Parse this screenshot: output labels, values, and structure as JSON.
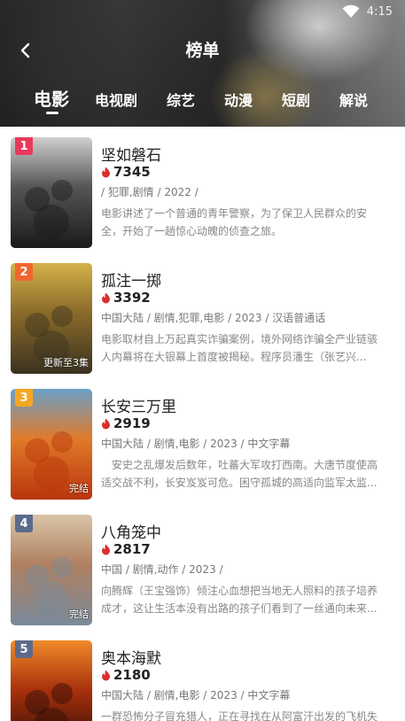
{
  "status_bar": {
    "time": "4:15"
  },
  "header": {
    "title": "榜单"
  },
  "tabs": [
    {
      "label": "电影",
      "active": true
    },
    {
      "label": "电视剧"
    },
    {
      "label": "综艺"
    },
    {
      "label": "动漫"
    },
    {
      "label": "短剧"
    },
    {
      "label": "解说"
    }
  ],
  "items": [
    {
      "rank": "1",
      "badge_color": "#e8395b",
      "title": "坚如磐石",
      "heat": "7345",
      "meta": " / 犯罪,剧情 / 2022 /",
      "desc": "电影讲述了一个普通的青年警察，为了保卫人民群众的安全，开始了一趟惊心动魄的侦查之旅。",
      "poster_label": "",
      "poster_palette": [
        "#1a1a1a",
        "#555555",
        "#cfcfcf"
      ]
    },
    {
      "rank": "2",
      "badge_color": "#f0662e",
      "title": "孤注一掷",
      "heat": "3392",
      "meta": "中国大陆 / 剧情,犯罪,电影 / 2023 / 汉语普通话",
      "desc": "电影取材自上万起真实诈骗案例，境外网络诈骗全产业链骇人内幕将在大银幕上首度被揭秘。程序员潘生（张艺兴...",
      "poster_label": "更新至3集",
      "poster_palette": [
        "#3a3220",
        "#8a6a2a",
        "#d4b24a"
      ]
    },
    {
      "rank": "3",
      "badge_color": "#f5a623",
      "title": "长安三万里",
      "heat": "2919",
      "meta": "中国大陆 / 剧情,电影 / 2023 / 中文字幕",
      "desc": "　安史之乱爆发后数年，吐蕃大军攻打西南。大唐节度使高适交战不利，长安岌岌可危。困守孤城的高适向监军太监...",
      "poster_label": "完结",
      "poster_palette": [
        "#b8360c",
        "#e07a2a",
        "#6aa0c8"
      ]
    },
    {
      "rank": "4",
      "badge_color": "#5b6b8a",
      "title": "八角笼中",
      "heat": "2817",
      "meta": "中国 / 剧情,动作 / 2023 /",
      "desc": "向腾辉（王宝强饰）倾注心血想把当地无人照料的孩子培养成才，这让生活本没有出路的孩子们看到了一丝通向未来...",
      "poster_label": "完结",
      "poster_palette": [
        "#7a8a9a",
        "#b08060",
        "#d9c4a8"
      ]
    },
    {
      "rank": "5",
      "badge_color": "#5b6b8a",
      "title": "奥本海默",
      "heat": "2180",
      "meta": "中国大陆 / 剧情,电影 / 2023 / 中文字幕",
      "desc": "一群恐怖分子冒充猎人，正在寻找在从阿富汗出发的飞机失事中幸存的...",
      "poster_label": "",
      "poster_palette": [
        "#2a0e06",
        "#a8300c",
        "#f08a2a"
      ]
    }
  ]
}
